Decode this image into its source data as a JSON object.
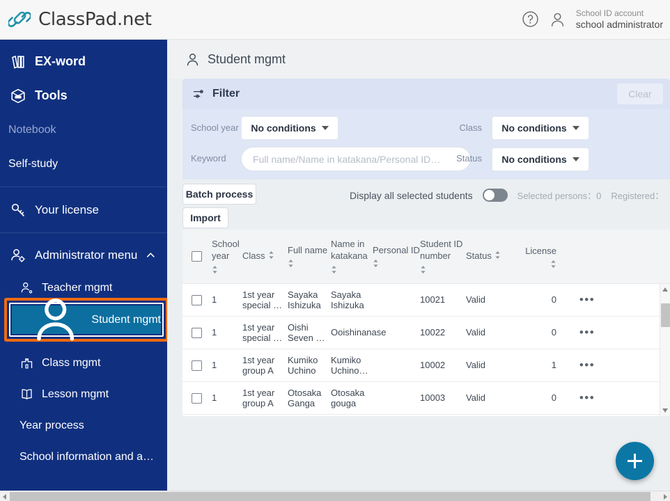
{
  "brand": {
    "name": "ClassPad.net",
    "logo_icon": "link-chain-icon"
  },
  "topbar": {
    "help_icon": "question-circle-icon",
    "user_icon": "person-icon",
    "account_label": "School ID account",
    "account_name": "school administrator"
  },
  "sidebar": {
    "primary": [
      {
        "label": "EX-word",
        "icon": "books-icon"
      },
      {
        "label": "Tools",
        "icon": "toolbox-icon"
      },
      {
        "label": "Notebook",
        "icon": "none"
      },
      {
        "label": "Self-study",
        "icon": "none"
      }
    ],
    "license": {
      "label": "Your license",
      "icon": "key-icon"
    },
    "admin": {
      "label": "Administrator menu",
      "icon": "admin-person-gear-icon",
      "chevron": "chevron-up-icon"
    },
    "admin_items": [
      {
        "label": "Teacher mgmt",
        "icon": "teacher-person-icon"
      },
      {
        "label": "Student mgmt",
        "icon": "student-person-icon",
        "selected": true
      },
      {
        "label": "Class mgmt",
        "icon": "school-building-icon"
      },
      {
        "label": "Lesson mgmt",
        "icon": "open-book-icon"
      },
      {
        "label": "Year process",
        "icon": "none"
      },
      {
        "label": "School information and a…",
        "icon": "none"
      }
    ]
  },
  "page": {
    "title": "Student mgmt",
    "icon": "person-icon"
  },
  "filter": {
    "title": "Filter",
    "icon": "sliders-icon",
    "clear_label": "Clear",
    "school_year_label": "School year",
    "school_year_value": "No conditions",
    "class_label": "Class",
    "class_value": "No conditions",
    "keyword_label": "Keyword",
    "keyword_value": "",
    "keyword_placeholder": "Full name/Name in katakana/Personal ID…",
    "status_label": "Status",
    "status_value": "No conditions"
  },
  "toolbar": {
    "batch_label": "Batch process",
    "import_label": "Import",
    "display_all_label": "Display all selected students",
    "toggle_on": false,
    "selected_persons": "Selected persons：0",
    "registered": "Registered："
  },
  "table": {
    "columns": [
      {
        "label": "",
        "sortable": false,
        "name": "select-all"
      },
      {
        "label": "School year",
        "sortable": true
      },
      {
        "label": "Class",
        "sortable": true
      },
      {
        "label": "Full name",
        "sortable": true
      },
      {
        "label": "Name in katakana",
        "sortable": true
      },
      {
        "label": "Personal ID",
        "sortable": true
      },
      {
        "label": "Student ID number",
        "sortable": true
      },
      {
        "label": "Status",
        "sortable": true
      },
      {
        "label": "License",
        "sortable": true
      },
      {
        "label": "",
        "sortable": false,
        "name": "actions"
      }
    ],
    "rows": [
      {
        "year": "1",
        "class": "1st year special …",
        "full_name": "Sayaka Ishizuka",
        "katakana": "Sayaka Ishizuka",
        "personal_id": "",
        "student_id": "10021",
        "status": "Valid",
        "license": "0",
        "actions": "•••"
      },
      {
        "year": "1",
        "class": "1st year special …",
        "full_name": "Oishi Seven …",
        "katakana": "Ooishinanase",
        "personal_id": "",
        "student_id": "10022",
        "status": "Valid",
        "license": "0",
        "actions": "•••"
      },
      {
        "year": "1",
        "class": "1st year group A",
        "full_name": "Kumiko Uchino",
        "katakana": "Kumiko Uchino…",
        "personal_id": "",
        "student_id": "10002",
        "status": "Valid",
        "license": "1",
        "actions": "•••"
      },
      {
        "year": "1",
        "class": "1st year group A",
        "full_name": "Otosaka Ganga",
        "katakana": "Otosaka gouga",
        "personal_id": "",
        "student_id": "10003",
        "status": "Valid",
        "license": "0",
        "actions": "•••"
      }
    ]
  },
  "fab": {
    "icon": "plus-icon",
    "label": "+"
  },
  "colors": {
    "sidebar_bg": "#10307f",
    "selected_item_bg": "#0c6fa0",
    "annotation": "#f06b10",
    "fab": "#0c77a5",
    "filter_bg": "#dfe6f5",
    "brand_teal": "#1a8fa8"
  }
}
